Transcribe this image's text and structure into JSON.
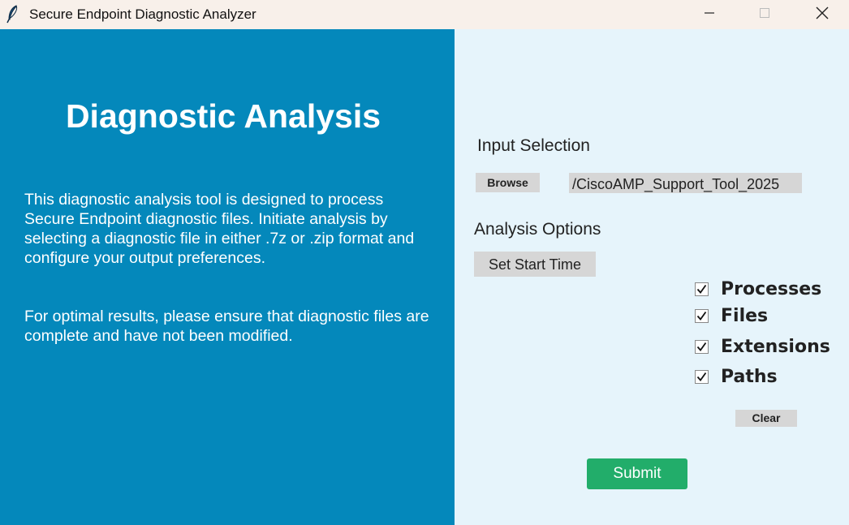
{
  "window": {
    "title": "Secure Endpoint Diagnostic Analyzer",
    "app_icon": "feather-icon",
    "controls": [
      "minimize-icon",
      "maximize-icon",
      "close-icon"
    ]
  },
  "left_panel": {
    "title": "Diagnostic Analysis",
    "description_1": "This diagnostic analysis tool is designed to process Secure Endpoint diagnostic files. Initiate analysis by selecting a diagnostic file in either .7z or .zip format and configure your output preferences.",
    "description_2": "For optimal results, please ensure that diagnostic files are complete and have not been modified.",
    "background_color": "#0488bb"
  },
  "right_panel": {
    "input_selection_title": "Input Selection",
    "browse_label": "Browse",
    "selected_path": "/CiscoAMP_Support_Tool_2025",
    "analysis_options_title": "Analysis Options",
    "set_start_time_label": "Set Start Time",
    "options": [
      {
        "label": "Processes",
        "checked": true
      },
      {
        "label": "Files",
        "checked": true
      },
      {
        "label": "Extensions",
        "checked": true
      },
      {
        "label": "Paths",
        "checked": true
      }
    ],
    "clear_label": "Clear",
    "submit_label": "Submit",
    "submit_color": "#22ad6a",
    "background_color": "#e6f4fb"
  }
}
